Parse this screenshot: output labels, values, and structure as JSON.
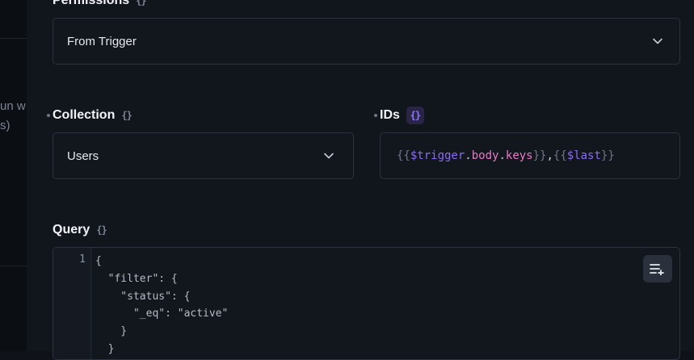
{
  "sidebar_fragment": {
    "line1": "un w",
    "line2": "s)"
  },
  "permissions": {
    "label": "Permissions",
    "value": "From Trigger"
  },
  "collection": {
    "label": "Collection",
    "value": "Users"
  },
  "ids": {
    "label": "IDs",
    "tokens": {
      "open1": "{{",
      "var1": "$trigger",
      "dot1": ".",
      "prop1": "body",
      "dot2": ".",
      "prop2": "keys",
      "close1": "}}",
      "comma": ",",
      "open2": "{{",
      "var2": "$last",
      "close2": "}}"
    }
  },
  "query": {
    "label": "Query",
    "line_number": "1",
    "code": "{\n  \"filter\": {\n    \"status\": {\n      \"_eq\": \"active\"\n    }\n  }"
  },
  "colors": {
    "accent_purple": "#8b6cf6",
    "prop_pink": "#e879c6",
    "background": "#11151c",
    "border": "#2c333e"
  },
  "icons": {
    "raw_toggle": "braces-icon",
    "dropdown": "chevron-down-icon",
    "format": "format-list-icon"
  }
}
